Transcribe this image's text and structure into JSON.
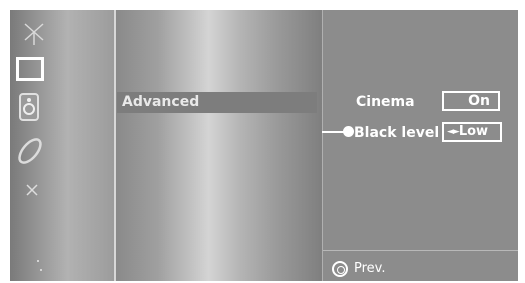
{
  "menu": {
    "selected_item": "Advanced"
  },
  "submenu": {
    "rows": [
      {
        "label": "Cinema",
        "value": "On"
      },
      {
        "label": "Black level",
        "value_arrows": "◄►",
        "value": "Low"
      }
    ]
  },
  "footer": {
    "prev_label": "Prev."
  },
  "icons": [
    "antenna-icon",
    "picture-icon",
    "sound-icon",
    "time-icon",
    "option-icon",
    "more-icon"
  ],
  "colors": {
    "text": "#ffffff",
    "selected_bg": "#7d7d7d",
    "panel_bg": "#8c8c8c"
  }
}
